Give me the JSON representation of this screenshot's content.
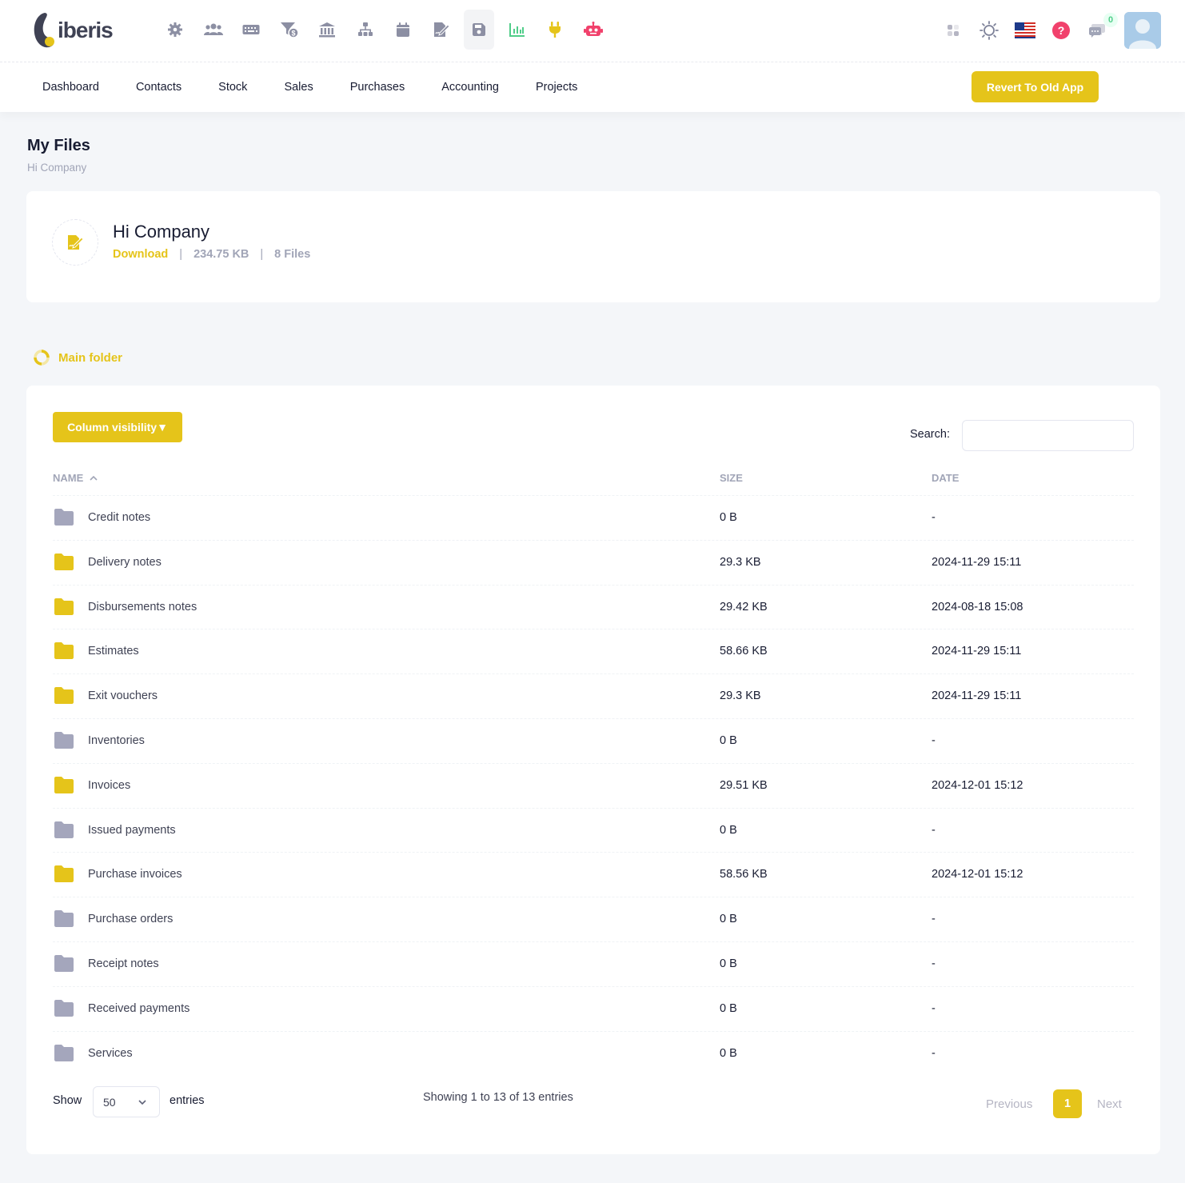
{
  "header": {
    "logo_text": "iberis",
    "notification_count": "0",
    "top_icons": [
      "gear-icon",
      "users-icon",
      "keyboard-icon",
      "filter-dollar-icon",
      "bank-icon",
      "sitemap-icon",
      "calendar-icon",
      "file-signature-icon",
      "save-icon",
      "chart-bar-icon",
      "plug-icon",
      "robot-icon"
    ],
    "right_icons": [
      "apps-icon",
      "sun-icon",
      "us-flag-icon",
      "help-icon",
      "chat-icon"
    ]
  },
  "nav": {
    "items": [
      {
        "label": "Dashboard"
      },
      {
        "label": "Contacts"
      },
      {
        "label": "Stock"
      },
      {
        "label": "Sales"
      },
      {
        "label": "Purchases"
      },
      {
        "label": "Accounting"
      },
      {
        "label": "Projects"
      }
    ],
    "revert_label": "Revert To Old App"
  },
  "page": {
    "title": "My Files",
    "subtitle": "Hi Company"
  },
  "company_card": {
    "name": "Hi Company",
    "download_label": "Download",
    "size": "234.75 KB",
    "files": "8 Files"
  },
  "breadcrumb": {
    "main_folder": "Main folder"
  },
  "table": {
    "column_visibility_label": "Column visibility▼",
    "search_label": "Search:",
    "search_value": "",
    "columns": {
      "name": "NAME",
      "size": "SIZE",
      "date": "DATE"
    },
    "rows": [
      {
        "name": "Credit notes",
        "size": "0 B",
        "date": "-",
        "filled": false
      },
      {
        "name": "Delivery notes",
        "size": "29.3 KB",
        "date": "2024-11-29 15:11",
        "filled": true
      },
      {
        "name": "Disbursements notes",
        "size": "29.42 KB",
        "date": "2024-08-18 15:08",
        "filled": true
      },
      {
        "name": "Estimates",
        "size": "58.66 KB",
        "date": "2024-11-29 15:11",
        "filled": true
      },
      {
        "name": "Exit vouchers",
        "size": "29.3 KB",
        "date": "2024-11-29 15:11",
        "filled": true
      },
      {
        "name": "Inventories",
        "size": "0 B",
        "date": "-",
        "filled": false
      },
      {
        "name": "Invoices",
        "size": "29.51 KB",
        "date": "2024-12-01 15:12",
        "filled": true
      },
      {
        "name": "Issued payments",
        "size": "0 B",
        "date": "-",
        "filled": false
      },
      {
        "name": "Purchase invoices",
        "size": "58.56 KB",
        "date": "2024-12-01 15:12",
        "filled": true
      },
      {
        "name": "Purchase orders",
        "size": "0 B",
        "date": "-",
        "filled": false
      },
      {
        "name": "Receipt notes",
        "size": "0 B",
        "date": "-",
        "filled": false
      },
      {
        "name": "Received payments",
        "size": "0 B",
        "date": "-",
        "filled": false
      },
      {
        "name": "Services",
        "size": "0 B",
        "date": "-",
        "filled": false
      }
    ],
    "footer": {
      "show_label": "Show",
      "page_size": "50",
      "entries_label": "entries",
      "showing_text": "Showing 1 to 13 of 13 entries",
      "previous_label": "Previous",
      "current_page": "1",
      "next_label": "Next"
    }
  },
  "colors": {
    "accent": "#e5c41a",
    "folder_filled": "#e5c41a",
    "folder_empty": "#a4a6bc",
    "help_red": "#f1416c",
    "chart_green": "#50cd89",
    "robot_red": "#f1416c"
  }
}
